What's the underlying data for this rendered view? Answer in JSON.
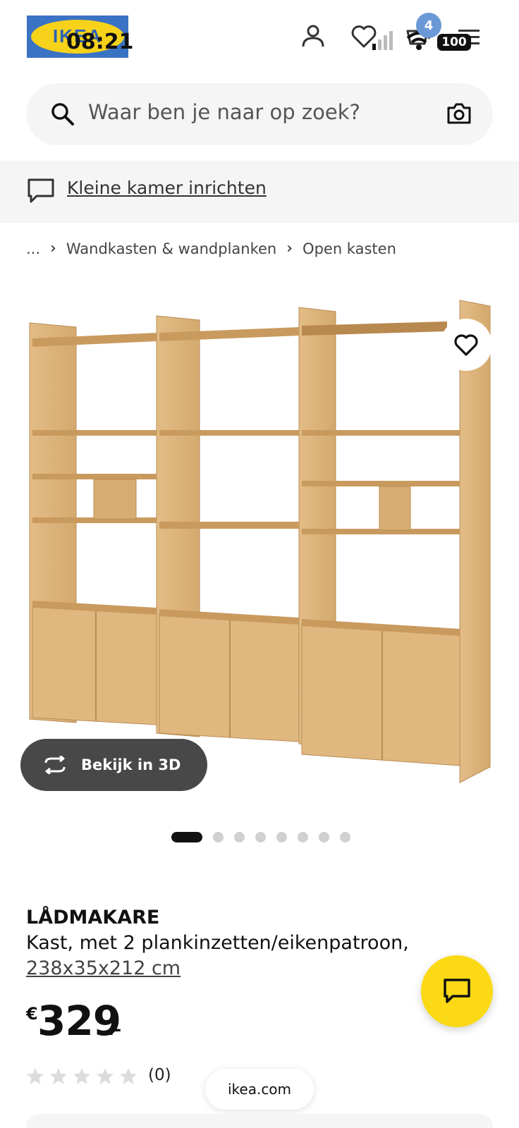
{
  "status_bar": {
    "time": "08:21",
    "battery": "100"
  },
  "header": {
    "logo_text": "IKEA",
    "cart_badge": "4"
  },
  "search": {
    "placeholder": "Waar ben je naar op zoek?"
  },
  "promo": {
    "text": "Kleine kamer inrichten"
  },
  "breadcrumb": {
    "items": [
      "...",
      "Wandkasten & wandplanken",
      "Open kasten"
    ]
  },
  "gallery": {
    "view3d_label": "Bekijk in 3D",
    "image_count": 8,
    "active_index": 0
  },
  "product": {
    "name": "LÅDMAKARE",
    "description": "Kast, met 2 plankinzetten/eikenpatroon,",
    "dimensions": "238x35x212 cm",
    "price_currency": "€",
    "price_amount": "329",
    "price_decimals": ".-",
    "rating_stars": 0,
    "rating_max": 5,
    "review_count": "(0)"
  },
  "browser": {
    "url": "ikea.com"
  },
  "colors": {
    "ikea_blue": "#3a72c4",
    "ikea_yellow": "#f7d21a",
    "chat_yellow": "#fbd914",
    "wood": "#dcb27a"
  },
  "icons": [
    "user-icon",
    "heart-icon",
    "cart-icon",
    "menu-icon",
    "search-icon",
    "camera-icon",
    "chat-bubble-icon",
    "rotate-3d-icon",
    "star-icon"
  ]
}
